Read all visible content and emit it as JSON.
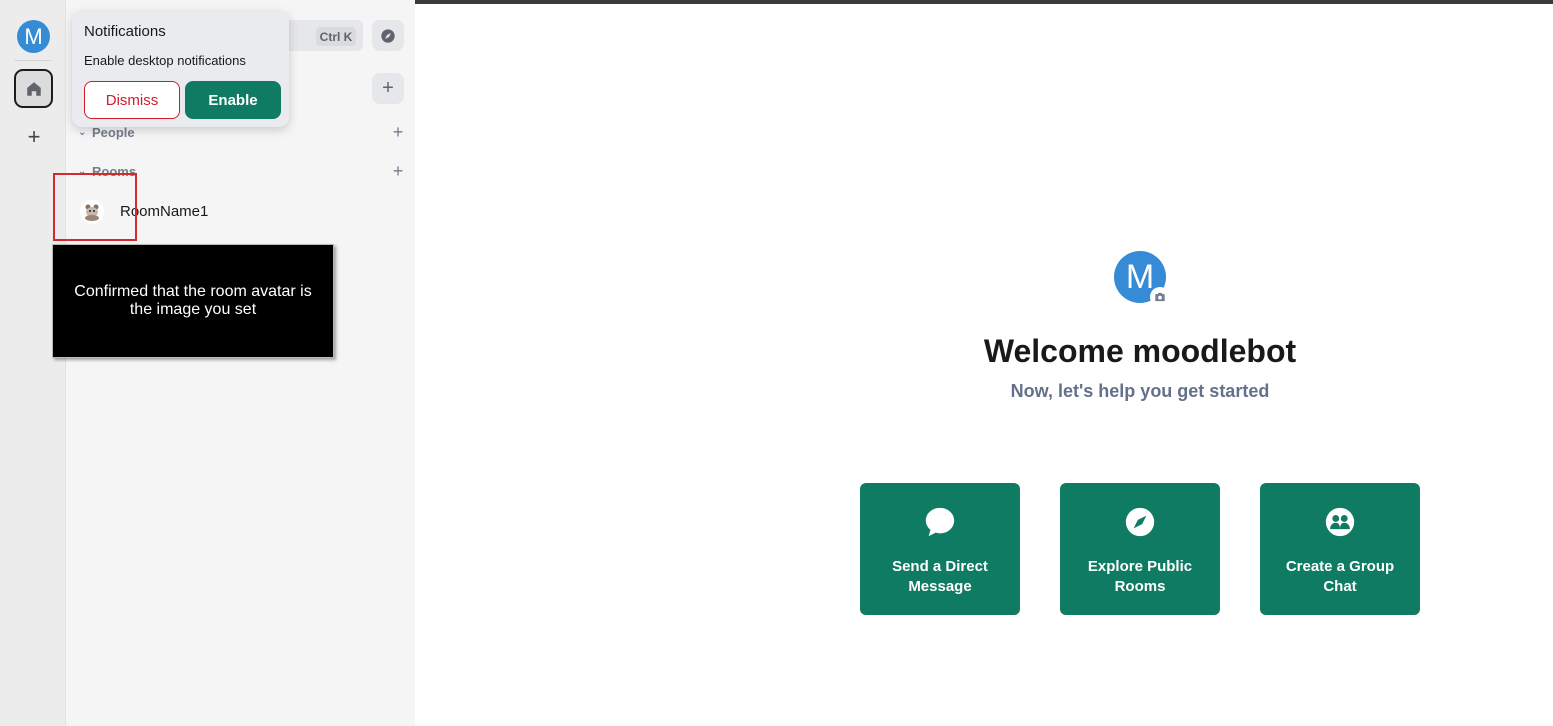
{
  "user": {
    "avatar_initial": "M"
  },
  "search": {
    "shortcut": "Ctrl K"
  },
  "sections": {
    "people": {
      "label": "People"
    },
    "rooms": {
      "label": "Rooms"
    }
  },
  "rooms": [
    {
      "name": "RoomName1"
    }
  ],
  "notification": {
    "title": "Notifications",
    "body": "Enable desktop notifications",
    "dismiss_label": "Dismiss",
    "enable_label": "Enable"
  },
  "annotation": {
    "caption": "Confirmed that the room avatar is the image you set"
  },
  "welcome": {
    "avatar_initial": "M",
    "title": "Welcome moodlebot",
    "subtitle": "Now, let's help you get started"
  },
  "actions": [
    {
      "label": "Send a Direct Message",
      "icon": "chat-bubble-icon"
    },
    {
      "label": "Explore Public Rooms",
      "icon": "compass-icon"
    },
    {
      "label": "Create a Group Chat",
      "icon": "group-icon"
    }
  ],
  "colors": {
    "accent": "#0f7b62",
    "avatar": "#368bd6",
    "danger": "#d11c2b",
    "annotation_box": "#d42a2a"
  }
}
